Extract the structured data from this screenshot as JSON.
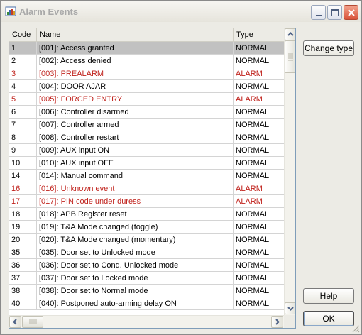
{
  "window": {
    "title": "Alarm Events"
  },
  "columns": {
    "code": "Code",
    "name": "Name",
    "type": "Type"
  },
  "rows": [
    {
      "code": "1",
      "name": "[001]: Access granted",
      "type": "NORMAL",
      "alarm": false,
      "selected": true
    },
    {
      "code": "2",
      "name": "[002]: Access denied",
      "type": "NORMAL",
      "alarm": false
    },
    {
      "code": "3",
      "name": "[003]: PREALARM",
      "type": "ALARM",
      "alarm": true
    },
    {
      "code": "4",
      "name": "[004]: DOOR AJAR",
      "type": "NORMAL",
      "alarm": false
    },
    {
      "code": "5",
      "name": "[005]: FORCED ENTRY",
      "type": "ALARM",
      "alarm": true
    },
    {
      "code": "6",
      "name": "[006]: Controller disarmed",
      "type": "NORMAL",
      "alarm": false
    },
    {
      "code": "7",
      "name": "[007]: Controller armed",
      "type": "NORMAL",
      "alarm": false
    },
    {
      "code": "8",
      "name": "[008]: Controller restart",
      "type": "NORMAL",
      "alarm": false
    },
    {
      "code": "9",
      "name": "[009]: AUX input ON",
      "type": "NORMAL",
      "alarm": false
    },
    {
      "code": "10",
      "name": "[010]: AUX input OFF",
      "type": "NORMAL",
      "alarm": false
    },
    {
      "code": "14",
      "name": "[014]: Manual command",
      "type": "NORMAL",
      "alarm": false
    },
    {
      "code": "16",
      "name": "[016]: Unknown event",
      "type": "ALARM",
      "alarm": true
    },
    {
      "code": "17",
      "name": "[017]: PIN code under duress",
      "type": "ALARM",
      "alarm": true
    },
    {
      "code": "18",
      "name": "[018]: APB Register reset",
      "type": "NORMAL",
      "alarm": false
    },
    {
      "code": "19",
      "name": "[019]: T&A Mode changed (toggle)",
      "type": "NORMAL",
      "alarm": false
    },
    {
      "code": "20",
      "name": "[020]: T&A Mode changed (momentary)",
      "type": "NORMAL",
      "alarm": false
    },
    {
      "code": "35",
      "name": "[035]: Door set to Unlocked mode",
      "type": "NORMAL",
      "alarm": false
    },
    {
      "code": "36",
      "name": "[036]: Door set to Cond. Unlocked mode",
      "type": "NORMAL",
      "alarm": false
    },
    {
      "code": "37",
      "name": "[037]: Door set to Locked mode",
      "type": "NORMAL",
      "alarm": false
    },
    {
      "code": "38",
      "name": "[038]: Door set to Normal mode",
      "type": "NORMAL",
      "alarm": false
    },
    {
      "code": "40",
      "name": "[040]: Postponed auto-arming delay ON",
      "type": "NORMAL",
      "alarm": false
    }
  ],
  "buttons": {
    "change_type": "Change type",
    "help": "Help",
    "ok": "OK"
  },
  "colors": {
    "alarm": "#c0231d",
    "selected": "#c1c1c1"
  },
  "icons": {
    "app": "alarm-events-icon",
    "minimize": "minimize-icon",
    "maximize": "maximize-icon",
    "close": "close-icon"
  }
}
